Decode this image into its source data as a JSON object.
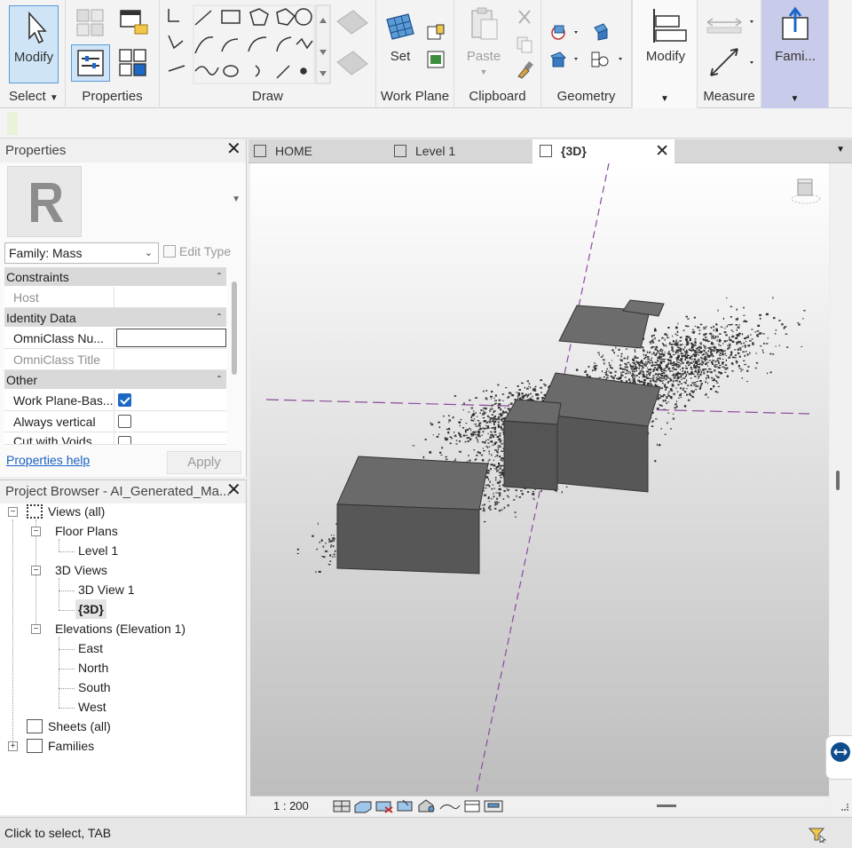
{
  "ribbon": {
    "select": {
      "modify_label": "Modify",
      "panel_label": "Select"
    },
    "properties": {
      "panel_label": "Properties"
    },
    "draw": {
      "panel_label": "Draw"
    },
    "work_plane": {
      "set_label": "Set",
      "panel_label": "Work Plane"
    },
    "clipboard": {
      "paste_label": "Paste",
      "panel_label": "Clipboard"
    },
    "geometry": {
      "panel_label": "Geometry"
    },
    "modify": {
      "label": "Modify"
    },
    "measure": {
      "panel_label": "Measure"
    },
    "family": {
      "label": "Fami..."
    }
  },
  "properties": {
    "title": "Properties",
    "family_select": "Family: Mass",
    "edit_type": "Edit Type",
    "groups": {
      "constraints": "Constraints",
      "identity": "Identity Data",
      "other": "Other"
    },
    "rows": {
      "host": "Host",
      "omniclass_num": "OmniClass Nu...",
      "omniclass_title": "OmniClass Title",
      "work_plane_based": "Work Plane-Bas...",
      "always_vertical": "Always vertical",
      "cut_with_voids": "Cut with Voids"
    },
    "work_plane_based_checked": true,
    "always_vertical_checked": false,
    "help_link": "Properties help",
    "apply": "Apply"
  },
  "browser": {
    "title": "Project Browser - AI_Generated_Ma...",
    "views_all": "Views (all)",
    "floor_plans": "Floor Plans",
    "level_1": "Level 1",
    "views_3d": "3D Views",
    "view_3d_1": "3D View 1",
    "view_3d": "{3D}",
    "elevations": "Elevations (Elevation 1)",
    "east": "East",
    "north": "North",
    "south": "South",
    "west": "West",
    "sheets": "Sheets (all)",
    "families": "Families"
  },
  "tabs": {
    "home": "HOME",
    "level1": "Level 1",
    "view3d": "{3D}"
  },
  "viewbar": {
    "scale": "1 : 200"
  },
  "status": {
    "text": "Click to select, TAB"
  },
  "colors": {
    "accent": "#1b68c7",
    "massing": "#5c5c5c",
    "family_tab": "#c9cbea",
    "workplane": "#8a4a9a"
  }
}
